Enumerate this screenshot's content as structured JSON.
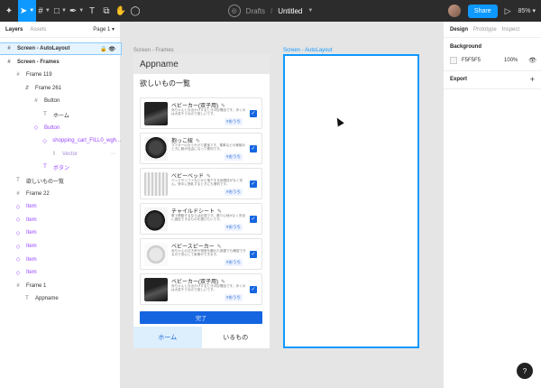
{
  "toolbar": {
    "tools": [
      {
        "name": "main-menu",
        "icon": "figma-logo-icon",
        "glyph": "✦",
        "caret": false,
        "active": false
      },
      {
        "name": "move-tool",
        "icon": "cursor-icon",
        "glyph": "➤",
        "caret": true,
        "active": true
      },
      {
        "name": "frame-tool",
        "icon": "frame-icon",
        "glyph": "#",
        "caret": true,
        "active": false
      },
      {
        "name": "shape-tool",
        "icon": "rectangle-icon",
        "glyph": "□",
        "caret": true,
        "active": false
      },
      {
        "name": "pen-tool",
        "icon": "pen-icon",
        "glyph": "✒",
        "caret": true,
        "active": false
      },
      {
        "name": "text-tool",
        "icon": "text-icon",
        "glyph": "T",
        "caret": false,
        "active": false
      },
      {
        "name": "resources-tool",
        "icon": "resources-icon",
        "glyph": "⧉",
        "caret": false,
        "active": false
      },
      {
        "name": "hand-tool",
        "icon": "hand-icon",
        "glyph": "✋",
        "caret": false,
        "active": false
      },
      {
        "name": "comment-tool",
        "icon": "comment-icon",
        "glyph": "◯",
        "caret": false,
        "active": false
      }
    ],
    "drafts": "Drafts",
    "separator": "/",
    "filename": "Untitled",
    "share_label": "Share",
    "zoom": "85%"
  },
  "left_panel": {
    "tabs": [
      "Layers",
      "Assets"
    ],
    "page": "Page 1",
    "layers": [
      {
        "label": "Screen - AutoLayout",
        "indent": 0,
        "icon": "#",
        "kind": "frame",
        "selected": true,
        "bold": true,
        "actions": "🔒 👁"
      },
      {
        "label": "Screen - Frames",
        "indent": 0,
        "icon": "#",
        "kind": "frame",
        "selected": false,
        "bold": true
      },
      {
        "label": "Frame 119",
        "indent": 1,
        "icon": "#",
        "kind": "frame"
      },
      {
        "label": "Frame 261",
        "indent": 2,
        "icon": "⇵",
        "kind": "frame"
      },
      {
        "label": "Button",
        "indent": 3,
        "icon": "#",
        "kind": "frame"
      },
      {
        "label": "ホーム",
        "indent": 4,
        "icon": "T",
        "kind": "text"
      },
      {
        "label": "Button",
        "indent": 3,
        "icon": "◇",
        "kind": "component"
      },
      {
        "label": "shopping_cart_FILL0_wgh...",
        "indent": 4,
        "icon": "◇",
        "kind": "component"
      },
      {
        "label": "Vector",
        "indent": 5,
        "icon": "⌇",
        "kind": "dim"
      },
      {
        "label": "ボタン",
        "indent": 4,
        "icon": "T",
        "kind": "component"
      },
      {
        "label": "欲しいもの一覧",
        "indent": 1,
        "icon": "T",
        "kind": "text"
      },
      {
        "label": "Frame 22",
        "indent": 1,
        "icon": "#",
        "kind": "frame"
      },
      {
        "label": "Item",
        "indent": 1,
        "icon": "◇",
        "kind": "component"
      },
      {
        "label": "Item",
        "indent": 1,
        "icon": "◇",
        "kind": "component"
      },
      {
        "label": "Item",
        "indent": 1,
        "icon": "◇",
        "kind": "component"
      },
      {
        "label": "Item",
        "indent": 1,
        "icon": "◇",
        "kind": "component"
      },
      {
        "label": "Item",
        "indent": 1,
        "icon": "◇",
        "kind": "component"
      },
      {
        "label": "Item",
        "indent": 1,
        "icon": "◇",
        "kind": "component"
      },
      {
        "label": "Frame 1",
        "indent": 1,
        "icon": "#",
        "kind": "frame"
      },
      {
        "label": "Appname",
        "indent": 2,
        "icon": "T",
        "kind": "text"
      }
    ]
  },
  "right_panel": {
    "tabs": [
      "Design",
      "Prototype",
      "Inspect"
    ],
    "background_title": "Background",
    "bg_color": "F5F5F5",
    "bg_opacity": "100%",
    "export_title": "Export"
  },
  "canvas": {
    "frame1_label": "Screen - Frames",
    "frame2_label": "Screen - AutoLayout",
    "app": {
      "appname": "Appname",
      "list_title": "欲しいもの一覧",
      "items": [
        {
          "name": "ベビーカー(双子用)",
          "desc": "赤ちゃんとお出かけするときの必需品です。歩くのは大変そうなので欲しいです。",
          "tag": "#おうち",
          "img": "img-stroller"
        },
        {
          "name": "抱っこ紐",
          "desc": "ライターのおでかけで重宝です。電車などの移動のときに腕が自由になって便利です。",
          "tag": "#おうち",
          "img": "img-carrier"
        },
        {
          "name": "ベビーベッド",
          "desc": "ベッドやソファなどから落下する危険性がなく安心。夜中に授乳するときにも便利です。",
          "tag": "#おうち",
          "img": "img-bed"
        },
        {
          "name": "チャイルドシート",
          "desc": "車で移動するならば必須です。乗り心地がよく安全に固定できるものを選びたいです。",
          "tag": "#おうち",
          "img": "img-seat"
        },
        {
          "name": "ベビースピーカー",
          "desc": "赤ちゃんの泣き声や物音を離れた部屋でも確認できるので安心して家事ができます。",
          "tag": "#おうち",
          "img": "img-speaker"
        },
        {
          "name": "ベビーカー(双子用)",
          "desc": "赤ちゃんとお出かけするときの必需品です。歩くのは大変そうなので欲しいです。",
          "tag": "#おうち",
          "img": "img-stroller"
        }
      ],
      "done_label": "完了",
      "nav": [
        "ホーム",
        "いるもの"
      ]
    }
  },
  "help_label": "?"
}
